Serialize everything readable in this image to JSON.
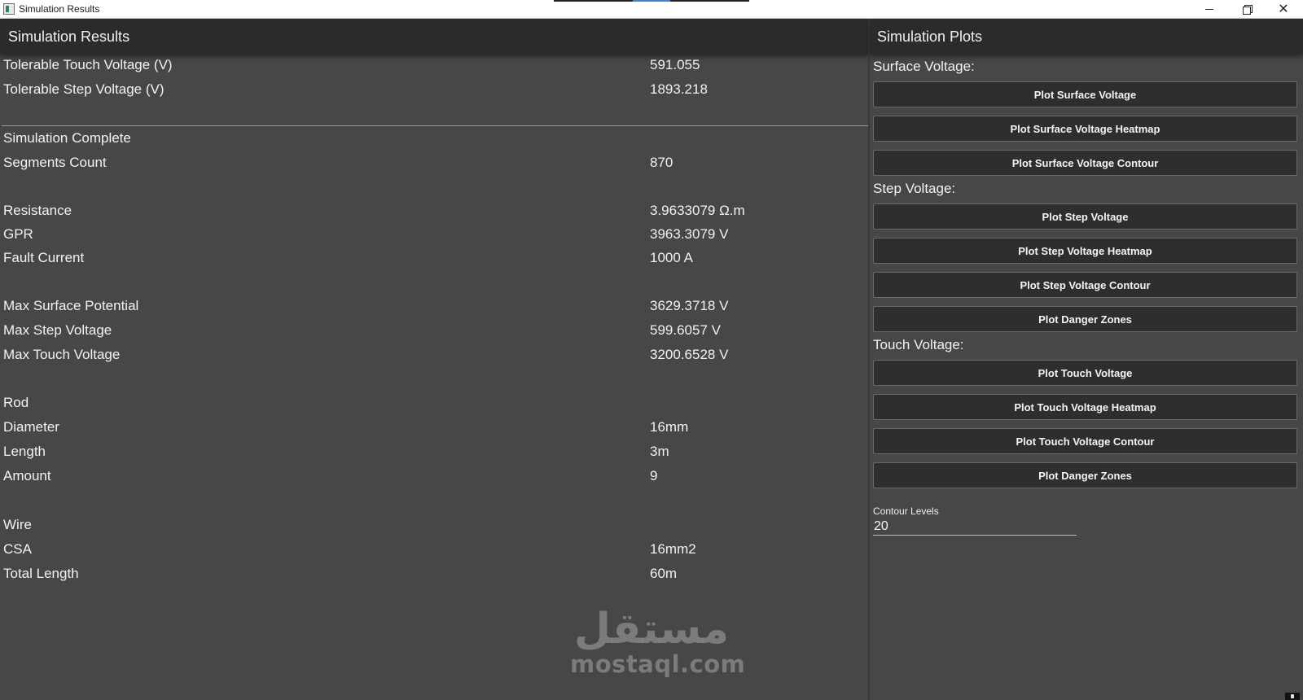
{
  "window": {
    "title": "Simulation Results",
    "minimize_label": "—",
    "close_label": "✕"
  },
  "results": {
    "header": "Simulation Results",
    "tolerable": [
      {
        "label": "Tolerable Touch Voltage (V)",
        "value": "591.055"
      },
      {
        "label": "Tolerable Step Voltage (V)",
        "value": "1893.218"
      }
    ],
    "status": "Simulation Complete",
    "segments": {
      "label": "Segments Count",
      "value": "870"
    },
    "electrical": [
      {
        "label": "Resistance",
        "value": "3.9633079 Ω.m"
      },
      {
        "label": "GPR",
        "value": "3963.3079 V"
      },
      {
        "label": "Fault Current",
        "value": "1000 A"
      }
    ],
    "maxima": [
      {
        "label": "Max Surface Potential",
        "value": "3629.3718 V"
      },
      {
        "label": "Max Step Voltage",
        "value": "599.6057 V"
      },
      {
        "label": "Max Touch Voltage",
        "value": "3200.6528 V"
      }
    ],
    "rod": {
      "title": "Rod",
      "items": [
        {
          "label": "Diameter",
          "value": "16mm"
        },
        {
          "label": "Length",
          "value": "3m"
        },
        {
          "label": "Amount",
          "value": "9"
        }
      ]
    },
    "wire": {
      "title": "Wire",
      "items": [
        {
          "label": "CSA",
          "value": "16mm2"
        },
        {
          "label": "Total Length",
          "value": "60m"
        }
      ]
    }
  },
  "plots": {
    "header": "Simulation Plots",
    "surface": {
      "title": "Surface Voltage:",
      "buttons": [
        "Plot Surface Voltage",
        "Plot Surface Voltage Heatmap",
        "Plot Surface Voltage Contour"
      ]
    },
    "step": {
      "title": "Step Voltage:",
      "buttons": [
        "Plot Step Voltage",
        "Plot Step Voltage Heatmap",
        "Plot Step Voltage Contour",
        "Plot Danger Zones"
      ]
    },
    "touch": {
      "title": "Touch Voltage:",
      "buttons": [
        "Plot Touch Voltage",
        "Plot Touch Voltage Heatmap",
        "Plot Touch Voltage Contour",
        "Plot Danger Zones"
      ]
    },
    "contour_levels": {
      "label": "Contour Levels",
      "value": "20"
    }
  },
  "watermark": {
    "arabic": "مستقل",
    "latin": "mostaql.com"
  }
}
